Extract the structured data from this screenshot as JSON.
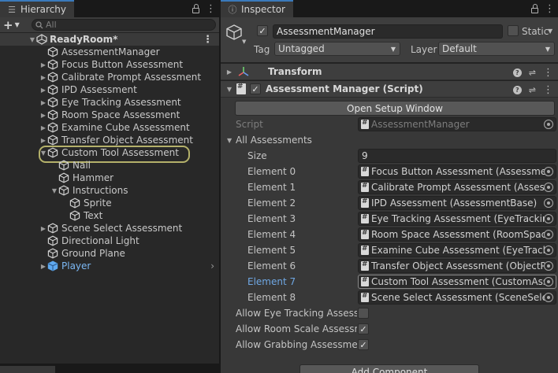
{
  "hierarchy": {
    "tab_title": "Hierarchy",
    "add_symbol": "+",
    "search_placeholder": "All",
    "scene": "ReadyRoom*",
    "items": [
      {
        "label": "AssessmentManager",
        "depth": 1,
        "expand": ""
      },
      {
        "label": "Focus Button Assessment",
        "depth": 1,
        "expand": "collapsed"
      },
      {
        "label": "Calibrate Prompt Assessment",
        "depth": 1,
        "expand": "collapsed"
      },
      {
        "label": "IPD Assessment",
        "depth": 1,
        "expand": "collapsed"
      },
      {
        "label": "Eye Tracking Assessment",
        "depth": 1,
        "expand": "collapsed"
      },
      {
        "label": "Room Space Assessment",
        "depth": 1,
        "expand": "collapsed"
      },
      {
        "label": "Examine Cube Assessment",
        "depth": 1,
        "expand": "collapsed"
      },
      {
        "label": "Transfer Object Assessment",
        "depth": 1,
        "expand": "collapsed"
      },
      {
        "label": "Custom Tool Assessment",
        "depth": 1,
        "expand": "expanded",
        "highlight": true
      },
      {
        "label": "Nail",
        "depth": 2,
        "expand": ""
      },
      {
        "label": "Hammer",
        "depth": 2,
        "expand": ""
      },
      {
        "label": "Instructions",
        "depth": 2,
        "expand": "expanded"
      },
      {
        "label": "Sprite",
        "depth": 3,
        "expand": ""
      },
      {
        "label": "Text",
        "depth": 3,
        "expand": ""
      },
      {
        "label": "Scene Select Assessment",
        "depth": 1,
        "expand": "collapsed"
      },
      {
        "label": "Directional Light",
        "depth": 1,
        "expand": ""
      },
      {
        "label": "Ground Plane",
        "depth": 1,
        "expand": ""
      },
      {
        "label": "Player",
        "depth": 1,
        "expand": "collapsed",
        "prefab": true
      }
    ]
  },
  "inspector": {
    "tab_title": "Inspector",
    "object_name": "AssessmentManager",
    "static_label": "Static",
    "tag_label": "Tag",
    "tag_value": "Untagged",
    "layer_label": "Layer",
    "layer_value": "Default",
    "components": {
      "transform": "Transform",
      "script": "Assessment Manager (Script)"
    },
    "setup_button": "Open Setup Window",
    "script_label": "Script",
    "script_value": "AssessmentManager",
    "list_label": "All Assessments",
    "size_label": "Size",
    "size_value": "9",
    "elements": [
      {
        "label": "Element 0",
        "value": "Focus Button Assessment (AssessmentBase)"
      },
      {
        "label": "Element 1",
        "value": "Calibrate Prompt Assessment (AssessmentBase)"
      },
      {
        "label": "Element 2",
        "value": "IPD Assessment (AssessmentBase)"
      },
      {
        "label": "Element 3",
        "value": "Eye Tracking Assessment (EyeTrackingAssessment)"
      },
      {
        "label": "Element 4",
        "value": "Room Space Assessment (RoomSpaceAssessment)"
      },
      {
        "label": "Element 5",
        "value": "Examine Cube Assessment (EyeTrackingAssessment)"
      },
      {
        "label": "Element 6",
        "value": "Transfer Object Assessment (ObjectPosAssessment)"
      },
      {
        "label": "Element 7",
        "value": "Custom Tool Assessment (CustomAssessment)",
        "selected": true
      },
      {
        "label": "Element 8",
        "value": "Scene Select Assessment (SceneSelectAssessment)"
      }
    ],
    "toggles": [
      {
        "label": "Allow Eye Tracking Assessment",
        "checked": false
      },
      {
        "label": "Allow Room Scale Assessment",
        "checked": true
      },
      {
        "label": "Allow Grabbing Assessment",
        "checked": true
      }
    ],
    "add_component": "Add Component"
  },
  "colors": {
    "accent_tab": "#3a79bb",
    "highlight_outline": "#b4b16a",
    "prefab_text": "#7cb8f4",
    "selected_label": "#6fa7e3"
  }
}
